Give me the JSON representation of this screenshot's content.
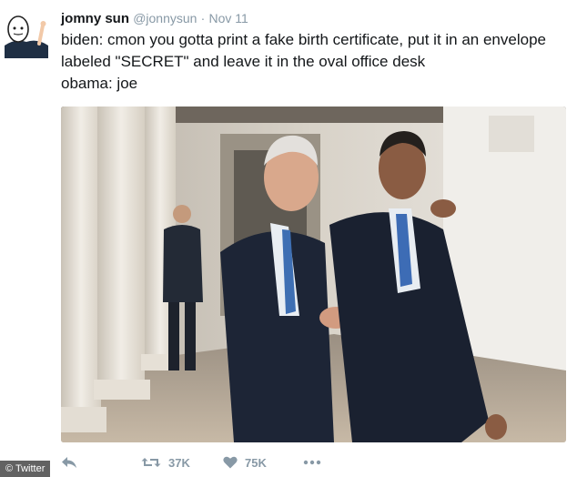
{
  "tweet": {
    "author": {
      "display_name": "jomny sun",
      "handle": "@jonnysun",
      "separator": "·",
      "timestamp": "Nov 11",
      "avatar_icon": "alien-doodle-avatar"
    },
    "text_lines": [
      "biden: cmon you gotta print a fake birth certificate, put it in an envelope",
      "labeled \"SECRET\" and leave it in the oval office desk",
      "obama: joe"
    ],
    "media": {
      "icon": "photo-biden-obama-colonnade"
    },
    "actions": {
      "reply_icon": "reply-icon",
      "retweet_icon": "retweet-icon",
      "retweet_count": "37K",
      "like_icon": "heart-icon",
      "like_count": "75K",
      "more_icon": "more-dots-icon"
    }
  },
  "credit": {
    "text": "© Twitter"
  },
  "colors": {
    "text": "#14171a",
    "muted": "#8899a6",
    "background": "#ffffff"
  }
}
